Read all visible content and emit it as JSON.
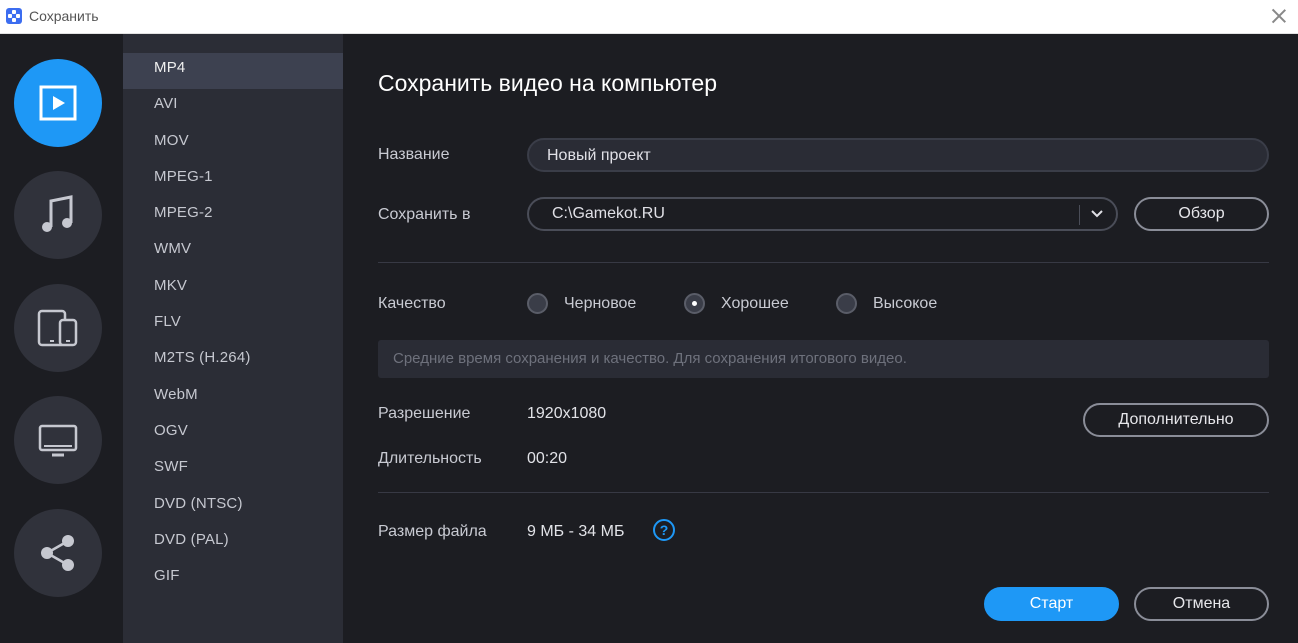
{
  "window": {
    "title": "Сохранить"
  },
  "categories": [
    {
      "icon": "video-icon",
      "active": true
    },
    {
      "icon": "music-icon",
      "active": false
    },
    {
      "icon": "devices-icon",
      "active": false
    },
    {
      "icon": "monitor-icon",
      "active": false
    },
    {
      "icon": "share-icon",
      "active": false
    }
  ],
  "formats": [
    "MP4",
    "AVI",
    "MOV",
    "MPEG-1",
    "MPEG-2",
    "WMV",
    "MKV",
    "FLV",
    "M2TS (H.264)",
    "WebM",
    "OGV",
    "SWF",
    "DVD (NTSC)",
    "DVD (PAL)",
    "GIF"
  ],
  "selected_format": "MP4",
  "main": {
    "heading": "Сохранить видео на компьютер",
    "name_label": "Название",
    "name_value": "Новый проект",
    "save_label": "Сохранить в",
    "save_path": "C:\\Gamekot.RU",
    "browse_button": "Обзор",
    "quality_label": "Качество",
    "quality_options": [
      "Черновое",
      "Хорошее",
      "Высокое"
    ],
    "quality_selected": "Хорошее",
    "quality_hint": "Средние время сохранения и качество. Для сохранения итогового видео.",
    "resolution_label": "Разрешение",
    "resolution_value": "1920x1080",
    "more_button": "Дополнительно",
    "duration_label": "Длительность",
    "duration_value": "00:20",
    "filesize_label": "Размер файла",
    "filesize_value": "9 МБ - 34 МБ",
    "help_symbol": "?",
    "start_button": "Старт",
    "cancel_button": "Отмена"
  },
  "colors": {
    "accent": "#1e98f6",
    "background": "#1c1d22",
    "sidebar": "#2b2d36"
  }
}
